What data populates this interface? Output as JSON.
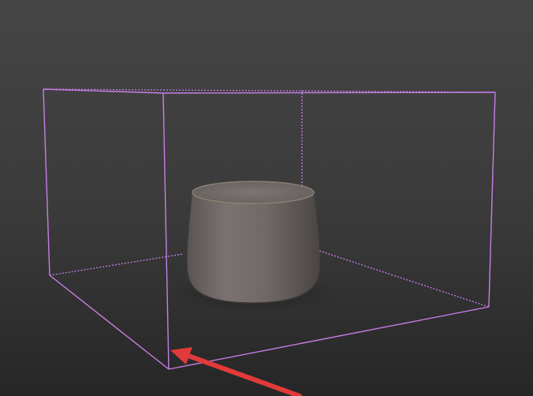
{
  "viewport": {
    "view": "perspective",
    "background_top": "#454545",
    "background_bottom": "#262626"
  },
  "selection_box": {
    "color": "#c77ee6",
    "style": "dashed-wireframe"
  },
  "object": {
    "type": "ottoman-cylinder",
    "color": "#6f6866"
  },
  "arrow_annotation": {
    "color": "#e23a3a",
    "points_to": "front-bottom-corner"
  }
}
